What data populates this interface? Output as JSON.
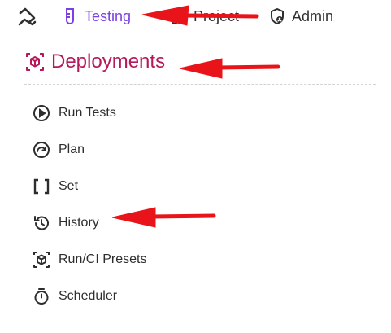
{
  "topnav": {
    "logo_icon": "pen-logo-icon",
    "items": [
      {
        "label": "Testing",
        "icon": "test-tube-icon",
        "active": true
      },
      {
        "label": "Project",
        "icon": "scissors-icon",
        "active": false
      },
      {
        "label": "Admin",
        "icon": "shield-user-icon",
        "active": false
      }
    ]
  },
  "section": {
    "title": "Deployments",
    "icon": "cube-icon"
  },
  "menu": {
    "items": [
      {
        "label": "Run Tests",
        "icon": "play-circle-icon"
      },
      {
        "label": "Plan",
        "icon": "redo-circle-icon"
      },
      {
        "label": "Set",
        "icon": "brackets-icon"
      },
      {
        "label": "History",
        "icon": "history-icon"
      },
      {
        "label": "Run/CI Presets",
        "icon": "cube-focus-icon"
      },
      {
        "label": "Scheduler",
        "icon": "timer-icon"
      }
    ]
  },
  "colors": {
    "active_nav": "#7b3fe4",
    "section_title": "#b5195b",
    "annotation_arrow": "#e8141a",
    "text": "#2d2d2d"
  }
}
